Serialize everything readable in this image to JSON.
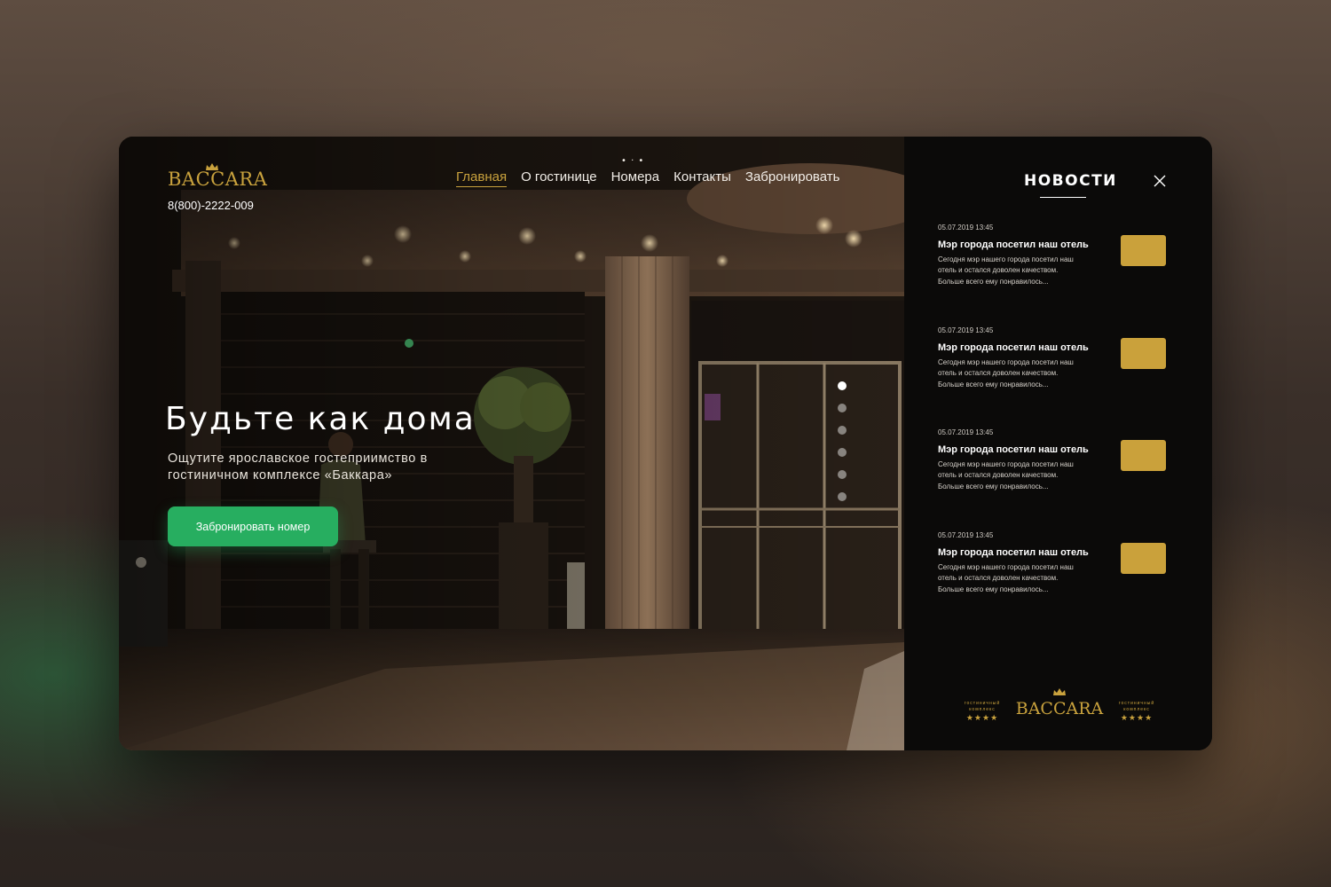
{
  "brand": {
    "name": "BACCARA",
    "phone": "8(800)-2222-009",
    "gold": "#c9a23d"
  },
  "nav": {
    "items": [
      {
        "label": "Главная",
        "active": true
      },
      {
        "label": "О гостинице",
        "active": false
      },
      {
        "label": "Номера",
        "active": false
      },
      {
        "label": "Контакты",
        "active": false
      },
      {
        "label": "Забронировать",
        "active": false
      }
    ]
  },
  "hero": {
    "title": "Будьте как дома",
    "subtitle": "Ощутите ярославское гостеприимство в гостиничном комплексе «Баккара»",
    "cta_label": "Забронировать номер",
    "cta_color": "#27ae60",
    "slides_count": 6,
    "active_slide": 1
  },
  "news": {
    "title": "НОВОСТИ",
    "close_icon": "close-icon",
    "items": [
      {
        "date": "05.07.2019 13:45",
        "title": "Мэр города посетил наш отель",
        "text": "Сегодня мэр нашего города посетил наш отель и остался доволен качеством. Больше всего ему понравилось..."
      },
      {
        "date": "05.07.2019 13:45",
        "title": "Мэр города посетил наш отель",
        "text": "Сегодня мэр нашего города посетил наш отель и остался доволен качеством. Больше всего ему понравилось..."
      },
      {
        "date": "05.07.2019 13:45",
        "title": "Мэр города посетил наш отель",
        "text": "Сегодня мэр нашего города посетил наш отель и остался доволен качеством. Больше всего ему понравилось..."
      },
      {
        "date": "05.07.2019 13:45",
        "title": "Мэр города посетил наш отель",
        "text": "Сегодня мэр нашего города посетил наш отель и остался доволен качеством. Больше всего ему понравилось..."
      }
    ],
    "thumb_color": "#caa13b"
  },
  "footer_logo": {
    "left_caption": "гостиничный комплекс",
    "main": "BACCARA",
    "right_caption": "гостиничный комплекс",
    "stars": "★★★★"
  }
}
